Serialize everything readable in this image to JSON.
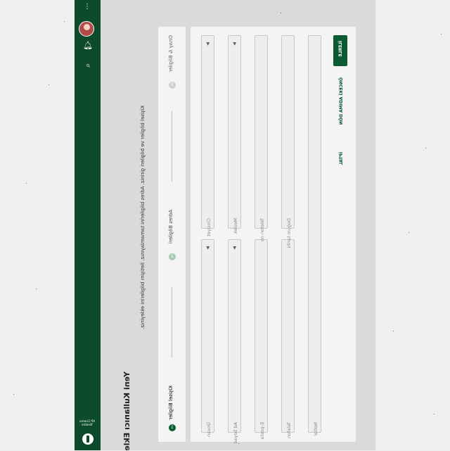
{
  "header": {
    "title": "Yeni Kullanıcı Ekle",
    "subtitle": "Kişisel bilgiler ve bilgileri giriniz. Adres bilgilerini tamamlayınız. İletişim bilgilerini ekleyiniz."
  },
  "sidebar": {
    "logo_text": "KP Cinema Yönetim",
    "icons": [
      "menu-dots-icon",
      "avatar",
      "notifications-icon",
      "search-icon"
    ]
  },
  "stepper": {
    "steps": [
      {
        "number": "1",
        "label": "Kişisel Bilgiler",
        "state": "active"
      },
      {
        "number": "2",
        "label": "Adres Bilgileri",
        "state": "pending"
      },
      {
        "number": "3",
        "label": "Onay & Bilgiler",
        "state": "pending"
      }
    ]
  },
  "form": {
    "fields": [
      {
        "placeholder": "Ünvan",
        "type": "select"
      },
      {
        "placeholder": "Cinsiyet",
        "type": "select"
      },
      {
        "placeholder": "Ad Soyad",
        "type": "text"
      },
      {
        "placeholder": "E-posta",
        "type": "text"
      },
      {
        "placeholder": "Telefon",
        "type": "text"
      },
      {
        "placeholder": "Meslek",
        "type": "select"
      },
      {
        "placeholder": "Telefon no",
        "type": "text"
      },
      {
        "placeholder": "Doğum tarihi",
        "type": "text"
      },
      {
        "placeholder": "Notlar",
        "type": "text"
      }
    ],
    "buttons": {
      "primary": "İLERLE",
      "secondary": "ÖNCEKİ ADIMA DÖN",
      "cancel": "İPTAL"
    }
  },
  "colors": {
    "brand": "#0b4a2a",
    "accent": "#0b5a32",
    "content_bg": "#d9dadb"
  }
}
